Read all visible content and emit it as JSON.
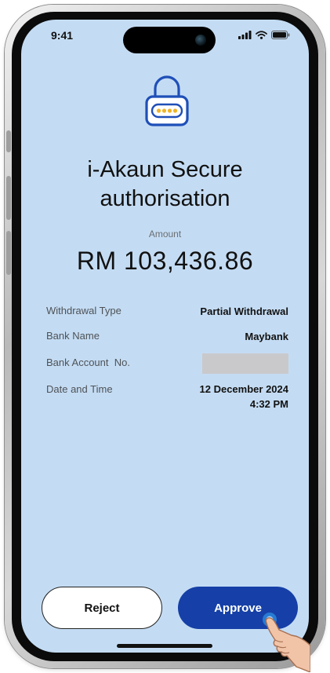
{
  "status_bar": {
    "time": "9:41"
  },
  "header": {
    "title_line1": "i-Akaun Secure",
    "title_line2": "authorisation"
  },
  "amount": {
    "label": "Amount",
    "value": "RM 103,436.86"
  },
  "details": {
    "rows": [
      {
        "label": "Withdrawal Type",
        "value": "Partial Withdrawal"
      },
      {
        "label": "Bank Name",
        "value": "Maybank"
      },
      {
        "label": "Bank Account  No.",
        "value": ""
      },
      {
        "label": "Date and Time",
        "value_line1": "12 December 2024",
        "value_line2": "4:32 PM"
      }
    ]
  },
  "actions": {
    "reject_label": "Reject",
    "approve_label": "Approve"
  },
  "colors": {
    "screen_background": "#c4dcf3",
    "approve_button": "#1640a7",
    "lock_icon_stroke": "#1f4fb8",
    "lock_dots": "#f0b429"
  },
  "icons": [
    "padlock-icon",
    "signal-icon",
    "wifi-icon",
    "battery-icon",
    "pointing-hand-icon"
  ]
}
